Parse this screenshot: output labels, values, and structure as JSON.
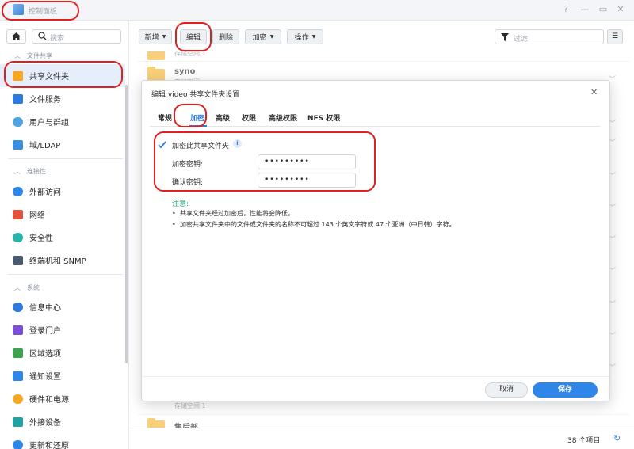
{
  "window": {
    "title": "控制面板",
    "help": "?",
    "minimize": "—",
    "maximize": "▭",
    "close": "✕"
  },
  "sidebar": {
    "search_placeholder": "搜索",
    "sections": [
      {
        "label": "文件共享"
      },
      {
        "label": "连接性"
      },
      {
        "label": "系统"
      }
    ],
    "items": [
      {
        "label": "共享文件夹",
        "color": "#f5a623"
      },
      {
        "label": "文件服务",
        "color": "#2e79de"
      },
      {
        "label": "用户与群组",
        "color": "#4fa3e0"
      },
      {
        "label": "域/LDAP",
        "color": "#3b8de0"
      },
      {
        "label": "外部访问",
        "color": "#2e86e8"
      },
      {
        "label": "网络",
        "color": "#e0533c"
      },
      {
        "label": "安全性",
        "color": "#26b5a8"
      },
      {
        "label": "终端机和 SNMP",
        "color": "#4a5a6e"
      },
      {
        "label": "信息中心",
        "color": "#2e79de"
      },
      {
        "label": "登录门户",
        "color": "#7b4fd6"
      },
      {
        "label": "区域选项",
        "color": "#3fa34d"
      },
      {
        "label": "通知设置",
        "color": "#2e86e8"
      },
      {
        "label": "硬件和电源",
        "color": "#f5a623"
      },
      {
        "label": "外接设备",
        "color": "#1fa3a0"
      },
      {
        "label": "更新和还原",
        "color": "#2e86e8"
      }
    ]
  },
  "toolbar": {
    "create": "新增",
    "edit": "编辑",
    "delete": "删除",
    "encrypt": "加密",
    "action": "操作",
    "filter_placeholder": "过滤"
  },
  "list": {
    "rows": [
      {
        "sub": "存储空间 1"
      },
      {
        "name": "syno",
        "sub": "存储空间"
      },
      {
        "sub": "存储空间 1"
      },
      {
        "name": "售后部"
      }
    ],
    "count": "38 个项目"
  },
  "dialog": {
    "title": "编辑 video 共享文件夹设置",
    "tabs": [
      "常规",
      "加密",
      "高级",
      "权限",
      "高级权限",
      "NFS 权限"
    ],
    "active_tab": 1,
    "encrypt_checkbox": "加密此共享文件夹",
    "key_label": "加密密钥:",
    "confirm_label": "确认密钥:",
    "key_value": "•••••••••",
    "confirm_value": "•••••••••",
    "note_title": "注意:",
    "notes": [
      "共享文件夹经过加密后，性能将会降低。",
      "加密共享文件夹中的文件或文件夹的名称不可超过 143 个英文字符或 47 个亚洲（中日韩）字符。"
    ],
    "cancel": "取消",
    "save": "保存"
  },
  "colors": {
    "accent": "#2e79de",
    "highlight": "#e02020",
    "note": "#2aa37a"
  }
}
